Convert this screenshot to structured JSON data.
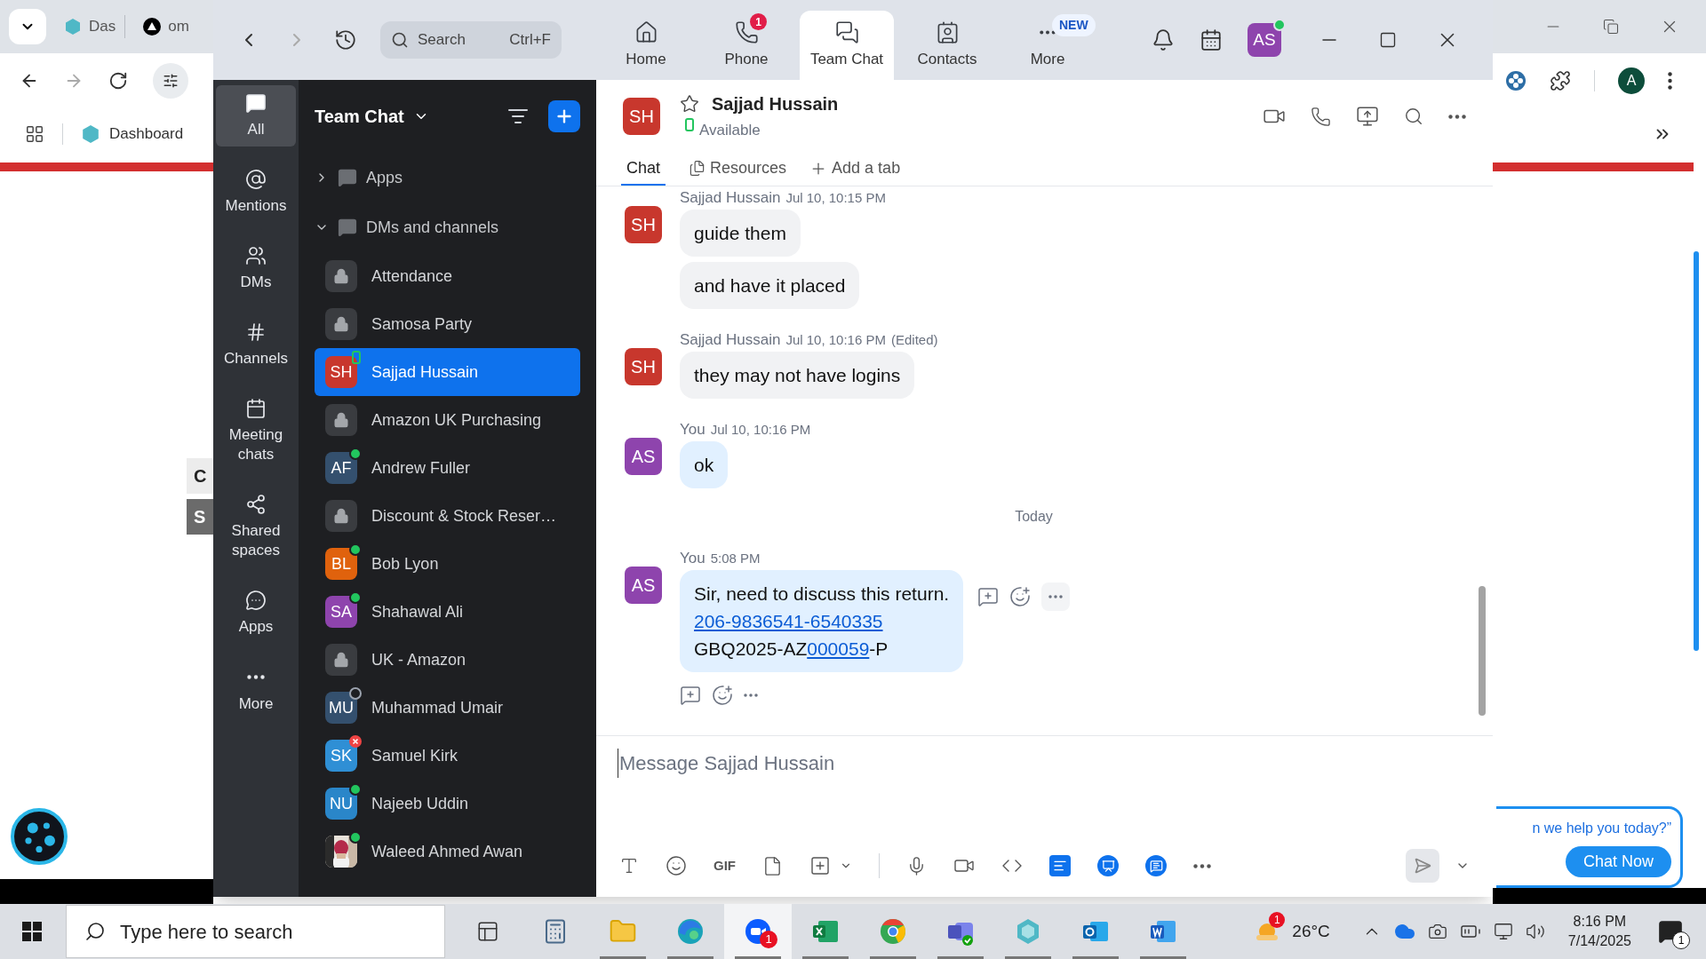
{
  "browser": {
    "tabs": [
      {
        "label": "Das",
        "kind": "hexagon"
      },
      {
        "label": "om",
        "kind": "triangle"
      }
    ],
    "bookmark": "Dashboard",
    "profile": "A",
    "page_rows": [
      {
        "label": "C",
        "kind": "light"
      },
      {
        "label": "S",
        "kind": "dark"
      }
    ],
    "chat_widget": {
      "prompt": "n we help you today?”",
      "button": "Chat Now"
    }
  },
  "zoom": {
    "search": {
      "placeholder": "Search",
      "shortcut": "Ctrl+F"
    },
    "nav_tabs": [
      {
        "label": "Home",
        "kind": "home",
        "selected": false
      },
      {
        "label": "Phone",
        "kind": "phone",
        "selected": false,
        "badge": "1"
      },
      {
        "label": "Team Chat",
        "kind": "chat",
        "selected": true
      },
      {
        "label": "Contacts",
        "kind": "contacts",
        "selected": false
      },
      {
        "label": "More",
        "kind": "more",
        "selected": false,
        "tag": "NEW"
      }
    ],
    "user": {
      "initials": "AS",
      "color": "#8e44ad",
      "presence": {
        "kind": "dot",
        "color": "#22c55e"
      }
    },
    "rail": [
      {
        "label": "All",
        "kind": "chat",
        "selected": true
      },
      {
        "label": "Mentions",
        "kind": "at",
        "selected": false
      },
      {
        "label": "DMs",
        "kind": "users",
        "selected": false
      },
      {
        "label": "Channels",
        "kind": "hash",
        "selected": false
      },
      {
        "label": "Meeting chats",
        "kind": "calendar",
        "selected": false
      },
      {
        "label": "Shared spaces",
        "kind": "share",
        "selected": false
      },
      {
        "label": "Apps",
        "kind": "apps",
        "selected": false
      },
      {
        "label": "More",
        "kind": "more",
        "selected": false
      }
    ],
    "panel": {
      "title": "Team Chat",
      "sections": [
        {
          "label": "Apps",
          "expanded": false
        },
        {
          "label": "DMs and channels",
          "expanded": true
        }
      ],
      "items": [
        {
          "kind": "channel",
          "name": "Attendance",
          "selected": false
        },
        {
          "kind": "channel",
          "name": "Samosa Party",
          "selected": false
        },
        {
          "kind": "person",
          "initials": "SH",
          "color": "#c8372d",
          "presence": {
            "kind": "mobile",
            "color": "#22c55e"
          },
          "name": "Sajjad Hussain",
          "selected": true
        },
        {
          "kind": "channel",
          "name": "Amazon UK Purchasing",
          "selected": false
        },
        {
          "kind": "person",
          "initials": "AF",
          "color": "#34506e",
          "presence": {
            "kind": "dot",
            "color": "#22c55e"
          },
          "name": "Andrew Fuller",
          "selected": false
        },
        {
          "kind": "channel",
          "name": "Discount & Stock Reser…",
          "selected": false
        },
        {
          "kind": "person",
          "initials": "BL",
          "color": "#e0620d",
          "presence": {
            "kind": "dot",
            "color": "#22c55e"
          },
          "name": "Bob Lyon",
          "selected": false
        },
        {
          "kind": "person",
          "initials": "SA",
          "color": "#8e44ad",
          "presence": {
            "kind": "dot",
            "color": "#22c55e"
          },
          "name": "Shahawal Ali",
          "selected": false
        },
        {
          "kind": "channel",
          "name": "UK - Amazon",
          "selected": false
        },
        {
          "kind": "person",
          "initials": "MU",
          "color": "#34506e",
          "presence": {
            "kind": "ring",
            "color": "#9ca3af"
          },
          "name": "Muhammad Umair",
          "selected": false
        },
        {
          "kind": "person",
          "initials": "SK",
          "color": "#2f8fd5",
          "presence": {
            "kind": "cross",
            "color": "#ef4444"
          },
          "name": "Samuel Kirk",
          "selected": false
        },
        {
          "kind": "person",
          "initials": "NU",
          "color": "#2a86c9",
          "presence": {
            "kind": "dot",
            "color": "#22c55e"
          },
          "name": "Najeeb Uddin",
          "selected": false
        },
        {
          "presence": {
            "kind": "dot",
            "color": "#22c55e"
          },
          "name": "Waleed Ahmed Awan",
          "selected": false
        }
      ]
    },
    "chat": {
      "contact": {
        "initials": "SH",
        "color": "#c8372d",
        "name": "Sajjad Hussain",
        "status": "Available",
        "presence": {
          "kind": "mobile",
          "color": "#22c55e"
        }
      },
      "tabs": [
        {
          "label": "Chat",
          "kind": "plain",
          "selected": true
        },
        {
          "label": "Resources",
          "kind": "files",
          "selected": false
        }
      ],
      "add_tab": "Add a tab",
      "messages": [
        {
          "kind": "group",
          "sender": "Sajjad Hussain",
          "time": "Jul 10, 10:15 PM",
          "initials": "SH",
          "color": "#c8372d",
          "mine": false,
          "show_actions": false,
          "bubbles": [
            {
              "lines": [
                [
                  {
                    "text": "guide them"
                  }
                ]
              ]
            },
            {
              "lines": [
                [
                  {
                    "text": "and have it placed"
                  }
                ]
              ]
            }
          ]
        },
        {
          "kind": "group",
          "sender": "Sajjad Hussain",
          "time": "Jul 10, 10:16 PM",
          "edited": "(Edited)",
          "initials": "SH",
          "color": "#c8372d",
          "mine": false,
          "show_actions": false,
          "bubbles": [
            {
              "lines": [
                [
                  {
                    "text": "they may not have logins"
                  }
                ]
              ]
            }
          ]
        },
        {
          "kind": "group",
          "sender": "You",
          "time": "Jul 10, 10:16 PM",
          "initials": "AS",
          "color": "#8e44ad",
          "mine": true,
          "show_actions": false,
          "bubbles": [
            {
              "lines": [
                [
                  {
                    "text": "ok"
                  }
                ]
              ]
            }
          ]
        },
        {
          "kind": "divider",
          "label": "Today"
        },
        {
          "kind": "group",
          "sender": "You",
          "time": "5:08 PM",
          "initials": "AS",
          "color": "#8e44ad",
          "mine": true,
          "show_actions": true,
          "bubbles": [
            {
              "lines": [
                [
                  {
                    "text": "Sir, need to discuss this return."
                  }
                ],
                [
                  {
                    "text": "206-9836541-6540335",
                    "link": true
                  }
                ],
                [
                  {
                    "text": "GBQ2025-AZ"
                  },
                  {
                    "text": "000059",
                    "link": true
                  },
                  {
                    "text": "-P"
                  }
                ]
              ]
            }
          ]
        }
      ],
      "composer": {
        "placeholder": "Message Sajjad Hussain",
        "gif": "GIF"
      }
    }
  },
  "taskbar": {
    "search_placeholder": "Type here to search",
    "apps": [
      {
        "kind": "task-view",
        "running": false,
        "selected": false
      },
      {
        "kind": "calculator",
        "running": false,
        "selected": false
      },
      {
        "kind": "folder",
        "running": true,
        "selected": false
      },
      {
        "kind": "edge",
        "running": true,
        "selected": false
      },
      {
        "kind": "zoom",
        "running": true,
        "selected": true,
        "badge": "1"
      },
      {
        "kind": "excel",
        "running": true,
        "selected": false
      },
      {
        "kind": "chrome",
        "running": true,
        "selected": false
      },
      {
        "kind": "teams",
        "running": true,
        "selected": false
      },
      {
        "kind": "hexagon",
        "running": true,
        "selected": false
      },
      {
        "kind": "outlook",
        "running": true,
        "selected": false
      },
      {
        "kind": "word",
        "running": true,
        "selected": false
      }
    ],
    "weather": {
      "badge": "1",
      "temperature": "26°C"
    },
    "time": "8:16 PM",
    "date": "7/14/2025",
    "notifications": "1"
  }
}
